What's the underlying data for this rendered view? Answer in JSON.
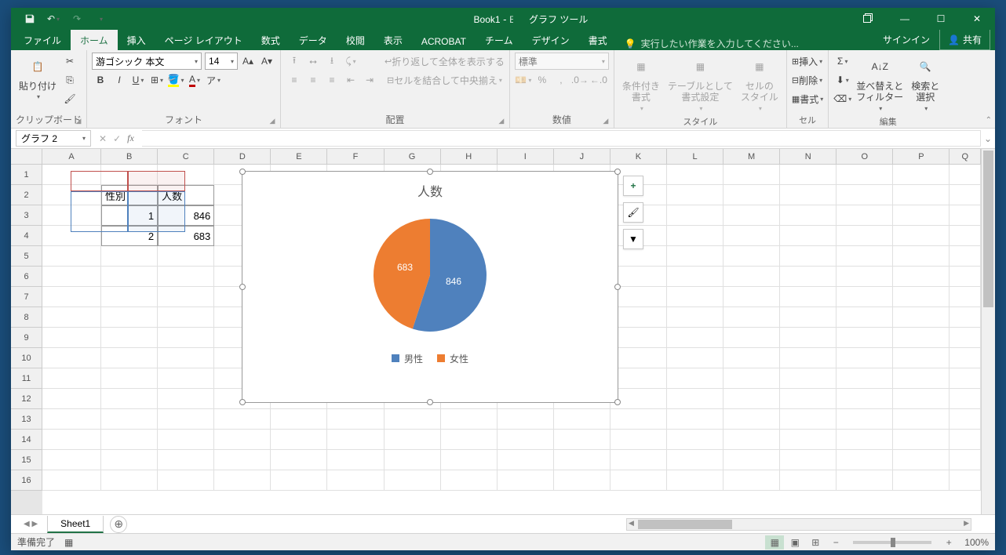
{
  "title": {
    "doc": "Book1",
    "app": "Excel",
    "chart_tools": "グラフ ツール"
  },
  "window_controls": {
    "restore": "❐",
    "min": "—",
    "max": "☐",
    "close": "✕"
  },
  "qat": {
    "save": "💾",
    "undo": "↶",
    "redo": "↷"
  },
  "tabs": {
    "file": "ファイル",
    "home": "ホーム",
    "insert": "挿入",
    "layout": "ページ レイアウト",
    "formulas": "数式",
    "data": "データ",
    "review": "校閲",
    "view": "表示",
    "acrobat": "ACROBAT",
    "team": "チーム",
    "design": "デザイン",
    "format": "書式",
    "tellme": "実行したい作業を入力してください...",
    "signin": "サインイン",
    "share": "共有"
  },
  "ribbon": {
    "clipboard": {
      "paste": "貼り付け",
      "label": "クリップボード"
    },
    "font": {
      "name": "游ゴシック 本文",
      "size": "14",
      "label": "フォント"
    },
    "align": {
      "wrap": "折り返して全体を表示する",
      "merge": "セルを結合して中央揃え",
      "label": "配置"
    },
    "number": {
      "format": "標準",
      "label": "数値"
    },
    "styles": {
      "cond": "条件付き\n書式",
      "table": "テーブルとして\n書式設定",
      "cell": "セルの\nスタイル",
      "label": "スタイル"
    },
    "cells": {
      "insert": "挿入",
      "delete": "削除",
      "format": "書式",
      "label": "セル"
    },
    "editing": {
      "sort": "並べ替えと\nフィルター",
      "find": "検索と\n選択",
      "label": "編集"
    }
  },
  "namebox": "グラフ 2",
  "columns": [
    "A",
    "B",
    "C",
    "D",
    "E",
    "F",
    "G",
    "H",
    "I",
    "J",
    "K",
    "L",
    "M",
    "N",
    "O",
    "P",
    "Q"
  ],
  "rows_shown": 16,
  "table": {
    "b2": "性別",
    "c2": "人数",
    "b3": "1",
    "c3": "846",
    "b4": "2",
    "c4": "683"
  },
  "chart": {
    "title": "人数",
    "legend": [
      "男性",
      "女性"
    ],
    "colors": {
      "male": "#4f81bd",
      "female": "#ed7d31"
    },
    "labels": {
      "male": "846",
      "female": "683"
    }
  },
  "chart_data": {
    "type": "pie",
    "title": "人数",
    "series": [
      {
        "name": "人数",
        "values": [
          846,
          683
        ]
      }
    ],
    "categories": [
      "男性",
      "女性"
    ]
  },
  "sheets": {
    "sheet1": "Sheet1"
  },
  "status": {
    "ready": "準備完了",
    "zoom": "100%"
  }
}
